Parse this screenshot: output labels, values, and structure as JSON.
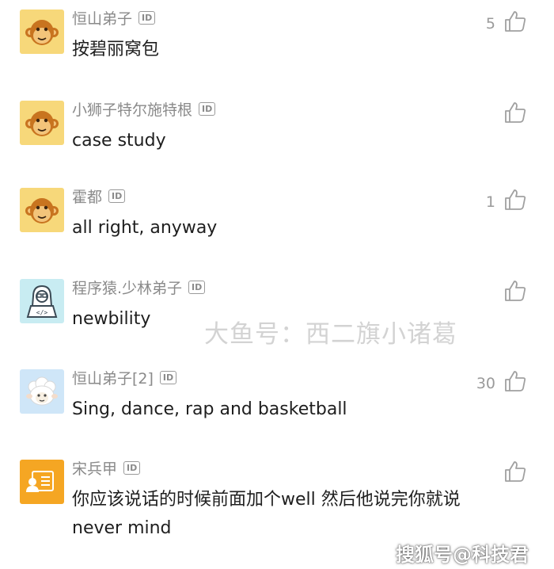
{
  "comments": [
    {
      "username": "恒山弟子",
      "id_badge": "ID",
      "text": "按碧丽窝包",
      "likes": "5",
      "avatar_icon": "monkey-icon"
    },
    {
      "username": "小狮子特尔施特根",
      "id_badge": "ID",
      "text": "case study",
      "likes": "",
      "avatar_icon": "monkey-icon"
    },
    {
      "username": "霍都",
      "id_badge": "ID",
      "text": "all right, anyway",
      "likes": "1",
      "avatar_icon": "monkey-icon"
    },
    {
      "username": "程序猿.少林弟子",
      "id_badge": "ID",
      "text": "newbility",
      "likes": "",
      "avatar_icon": "programmer-icon"
    },
    {
      "username": "恒山弟子[2]",
      "id_badge": "ID",
      "text": "Sing, dance, rap and basketball",
      "likes": "30",
      "avatar_icon": "sheep-icon"
    },
    {
      "username": "宋兵甲",
      "id_badge": "ID",
      "text": "你应该说话的时候前面加个well  然后他说完你就说never mind",
      "likes": "",
      "avatar_icon": "profile-card-icon"
    }
  ],
  "like_icon": "thumbs-up-icon",
  "watermark": "大鱼号：西二旗小诸葛",
  "corner_watermark": "搜狐号@科技君",
  "colors": {
    "username": "#8a8a8a",
    "text": "#1e1e1e",
    "monkey_bg": "#f7d87a",
    "programmer_bg": "#c8ecf2",
    "sheep_bg": "#cfe6f8",
    "card_bg": "#f5a623"
  }
}
